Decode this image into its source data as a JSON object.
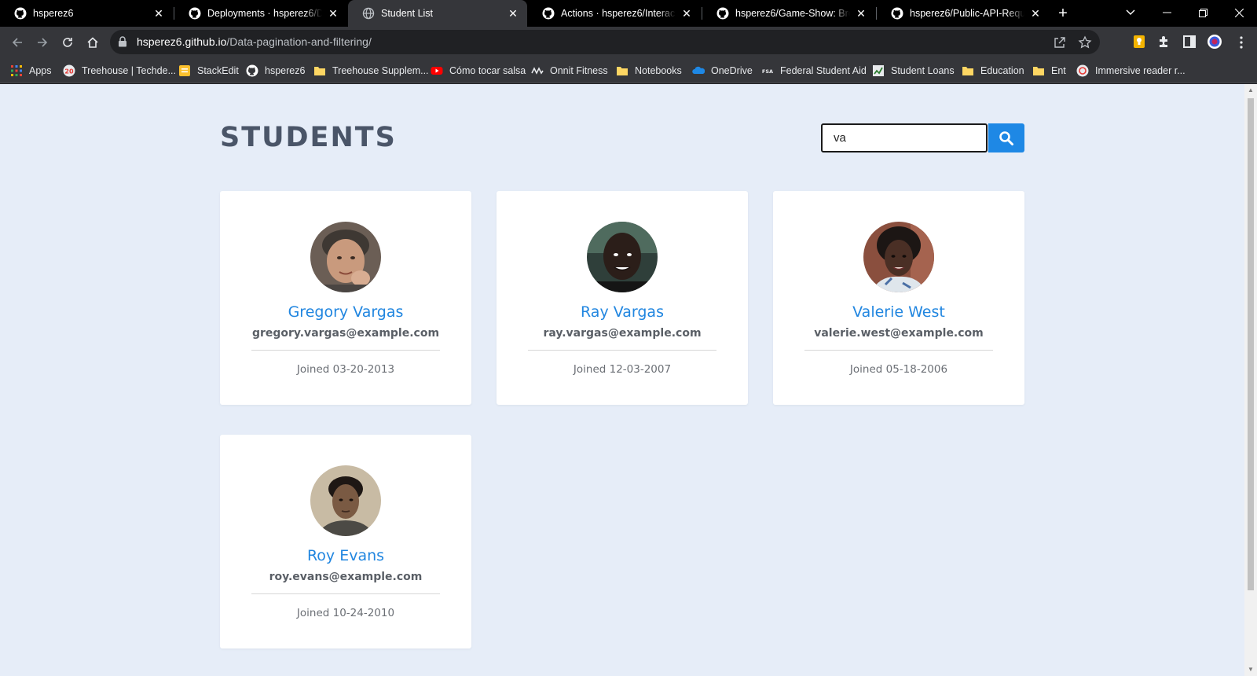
{
  "browser": {
    "tabs": [
      {
        "label": "hsperez6",
        "icon": "github-icon",
        "active": false
      },
      {
        "label": "Deployments · hsperez6/Data-pagination-and-filtering",
        "icon": "github-icon",
        "active": false
      },
      {
        "label": "Student List",
        "icon": "globe-icon",
        "active": true
      },
      {
        "label": "Actions · hsperez6/Interactive-Form",
        "icon": "github-icon",
        "active": false
      },
      {
        "label": "hsperez6/Game-Show: Browser game",
        "icon": "github-icon",
        "active": false
      },
      {
        "label": "hsperez6/Public-API-Requests",
        "icon": "github-icon",
        "active": false
      }
    ],
    "url": {
      "host": "hsperez6.github.io",
      "path": "/Data-pagination-and-filtering/"
    },
    "bookmarks": [
      {
        "label": "Apps",
        "icon": "apps-grid-icon"
      },
      {
        "label": "Treehouse | Techde...",
        "icon": "treehouse-icon"
      },
      {
        "label": "StackEdit",
        "icon": "stackedit-icon"
      },
      {
        "label": "hsperez6",
        "icon": "github-icon"
      },
      {
        "label": "Treehouse Supplem...",
        "icon": "folder-icon"
      },
      {
        "label": "Cómo tocar salsa",
        "icon": "youtube-icon"
      },
      {
        "label": "Onnit Fitness",
        "icon": "onnit-icon"
      },
      {
        "label": "Notebooks",
        "icon": "folder-icon"
      },
      {
        "label": "OneDrive",
        "icon": "onedrive-icon"
      },
      {
        "label": "Federal Student Aid",
        "icon": "fsa-icon"
      },
      {
        "label": "Student Loans",
        "icon": "loans-icon"
      },
      {
        "label": "Education",
        "icon": "folder-icon"
      },
      {
        "label": "Ent",
        "icon": "folder-icon"
      },
      {
        "label": "Immersive reader r...",
        "icon": "immersive-reader-icon"
      }
    ]
  },
  "page": {
    "title": "STUDENTS",
    "search": {
      "value": "va",
      "icon": "search-icon"
    },
    "students": [
      {
        "name": "Gregory Vargas",
        "email": "gregory.vargas@example.com",
        "joined": "Joined 03-20-2013"
      },
      {
        "name": "Ray Vargas",
        "email": "ray.vargas@example.com",
        "joined": "Joined 12-03-2007"
      },
      {
        "name": "Valerie West",
        "email": "valerie.west@example.com",
        "joined": "Joined 05-18-2006"
      },
      {
        "name": "Roy Evans",
        "email": "roy.evans@example.com",
        "joined": "Joined 10-24-2010"
      }
    ]
  },
  "colors": {
    "page_background": "#e6edf8",
    "accent": "#1e88e5",
    "name_text": "#2186e0",
    "title_text": "#4a5568"
  }
}
